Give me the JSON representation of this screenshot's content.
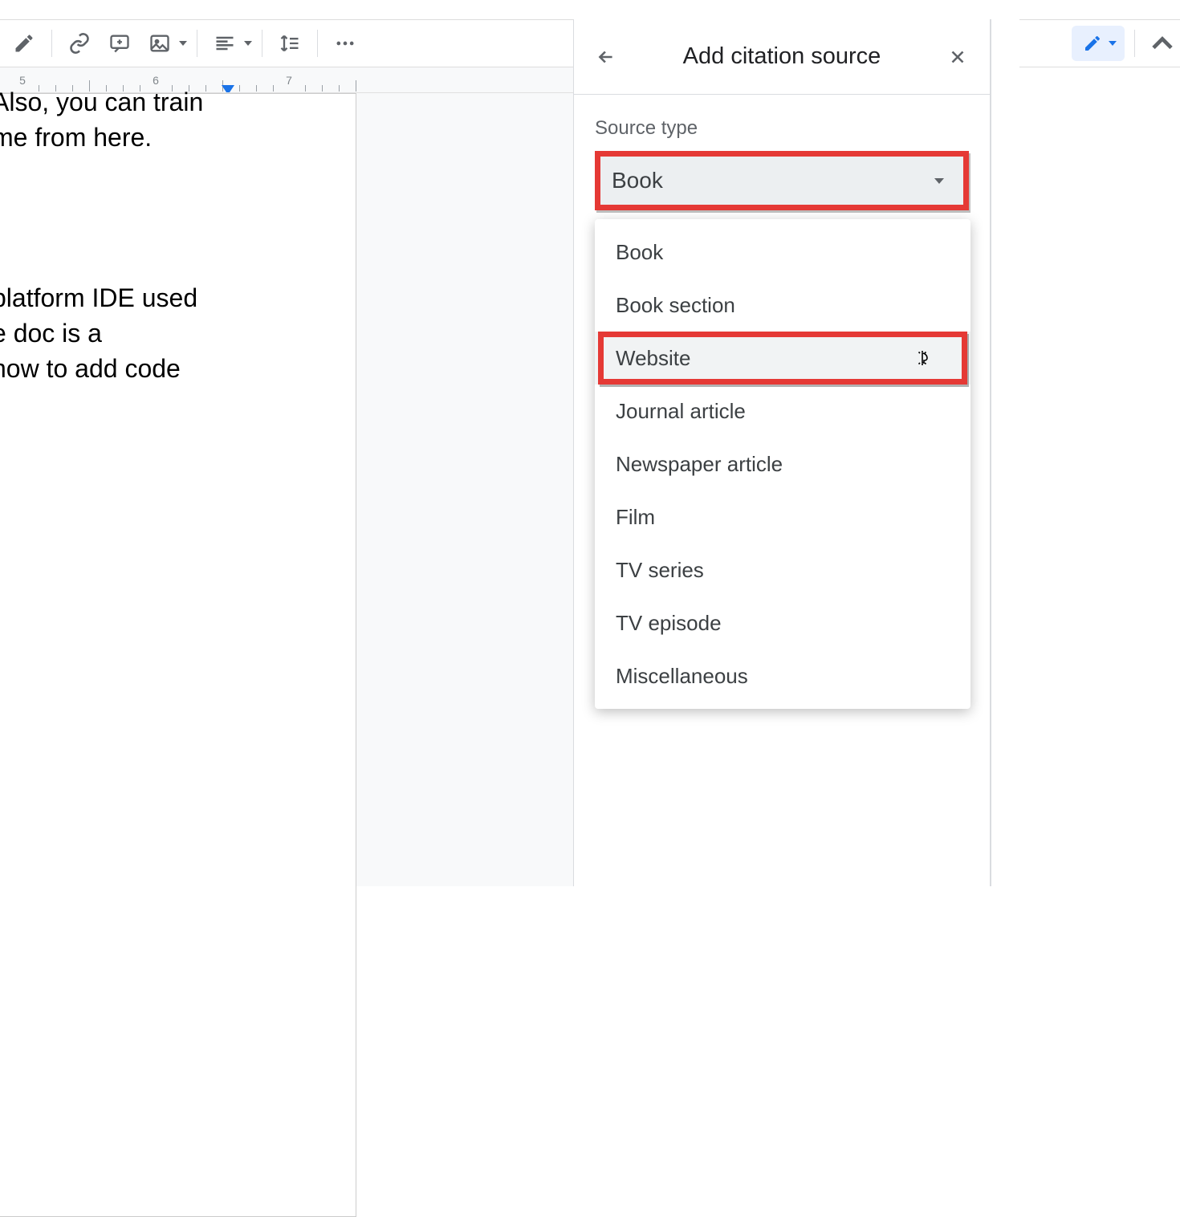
{
  "toolbar": {
    "icons": [
      "paint-format",
      "insert-link",
      "add-comment",
      "insert-image",
      "align",
      "line-spacing",
      "more"
    ],
    "edit_mode": "Editing"
  },
  "ruler": {
    "marks": [
      5,
      6,
      7
    ]
  },
  "document": {
    "line1": "Also, you can train",
    "line2": "me from here.",
    "line3": "platform IDE used",
    "line4": "e doc is a",
    "line5": "how to add code"
  },
  "panel": {
    "title": "Add citation source",
    "label": "Source type",
    "selected": "Book",
    "options": [
      "Book",
      "Book section",
      "Website",
      "Journal article",
      "Newspaper article",
      "Film",
      "TV series",
      "TV episode",
      "Miscellaneous"
    ],
    "highlighted_index": 2
  }
}
